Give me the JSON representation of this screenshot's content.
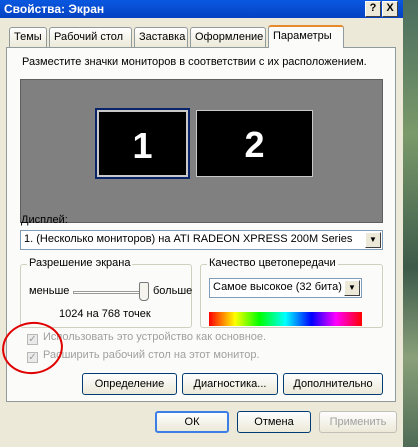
{
  "window": {
    "title": "Свойства: Экран",
    "help_label": "?",
    "close_label": "X"
  },
  "tabs": [
    {
      "label": "Темы",
      "active": false
    },
    {
      "label": "Рабочий стол",
      "active": false
    },
    {
      "label": "Заставка",
      "active": false
    },
    {
      "label": "Оформление",
      "active": false
    },
    {
      "label": "Параметры",
      "active": true
    }
  ],
  "hint": "Разместите значки мониторов в соответствии с их расположением.",
  "monitors": [
    {
      "label": "1",
      "selected": true
    },
    {
      "label": "2",
      "selected": false
    }
  ],
  "display": {
    "label": "Дисплей:",
    "value": "1. (Несколько мониторов) на ATI RADEON XPRESS 200M Series"
  },
  "resolution": {
    "title": "Разрешение экрана",
    "less_label": "меньше",
    "more_label": "больше",
    "value_text": "1024 на 768 точек",
    "slider_level": 1.0
  },
  "color_quality": {
    "title": "Качество цветопередачи",
    "value": "Самое высокое (32 бита)"
  },
  "checkboxes": [
    {
      "label": "Использовать это устройство как основное.",
      "checked": true,
      "disabled": true
    },
    {
      "label": "Расширить рабочий стол на этот монитор.",
      "checked": true,
      "disabled": true
    }
  ],
  "panel_buttons": {
    "identify": "Определение",
    "troubleshoot": "Диагностика...",
    "advanced": "Дополнительно"
  },
  "dialog_buttons": {
    "ok": "ОК",
    "cancel": "Отмена",
    "apply": "Применить"
  },
  "icons": {
    "dropdown": "chevron-down-icon",
    "check": "check-icon"
  },
  "colors": {
    "titlebar": "#0342c2",
    "dialog_bg": "#ece9d8",
    "monitor_area": "#808080",
    "annotation": "#e00000"
  }
}
